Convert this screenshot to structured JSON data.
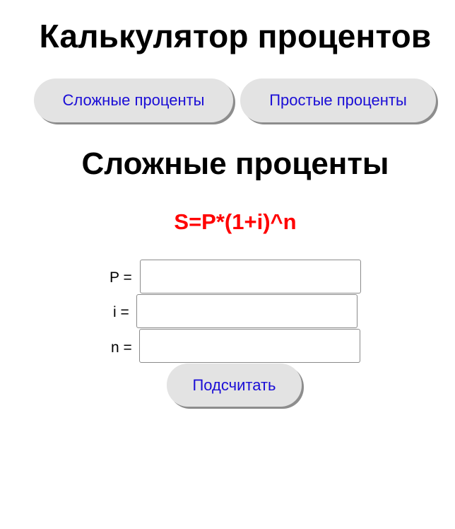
{
  "app": {
    "title": "Калькулятор процентов"
  },
  "tabs": [
    {
      "label": "Сложные проценты"
    },
    {
      "label": "Простые проценты"
    }
  ],
  "section": {
    "title": "Сложные проценты",
    "formula": "S=P*(1+i)^n"
  },
  "form": {
    "fields": [
      {
        "label": "P =",
        "value": "",
        "placeholder": ""
      },
      {
        "label": "i =",
        "value": "",
        "placeholder": ""
      },
      {
        "label": "n =",
        "value": "",
        "placeholder": ""
      }
    ],
    "submit_label": "Подсчитать"
  },
  "colors": {
    "link_text": "#1a0dd6",
    "button_bg": "#e3e3e3",
    "formula": "#ff0000"
  }
}
